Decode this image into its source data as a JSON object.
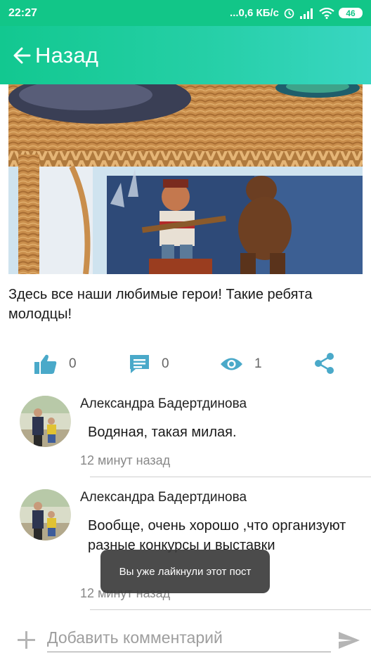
{
  "status_bar": {
    "time": "22:27",
    "network_speed": "...0,6 КБ/с",
    "battery": "46"
  },
  "app_bar": {
    "back_label": "Назад"
  },
  "post": {
    "text": "Здесь все наши любимые герои! Такие ребята молодцы!",
    "likes": "0",
    "comments": "0",
    "views": "1"
  },
  "comments": [
    {
      "author": "Александра Бадертдинова",
      "text": "Водяная, такая милая.",
      "time": "12 минут назад"
    },
    {
      "author": "Александра Бадертдинова",
      "text": "Вообще, очень хорошо ,что организуют разные конкурсы и выставки",
      "time": "12 минут назад"
    }
  ],
  "toast": {
    "message": "Вы уже лайкнули этот пост"
  },
  "comment_input": {
    "placeholder": "Добавить комментарий"
  },
  "colors": {
    "accent": "#12c688",
    "icon": "#4aa9c9"
  }
}
